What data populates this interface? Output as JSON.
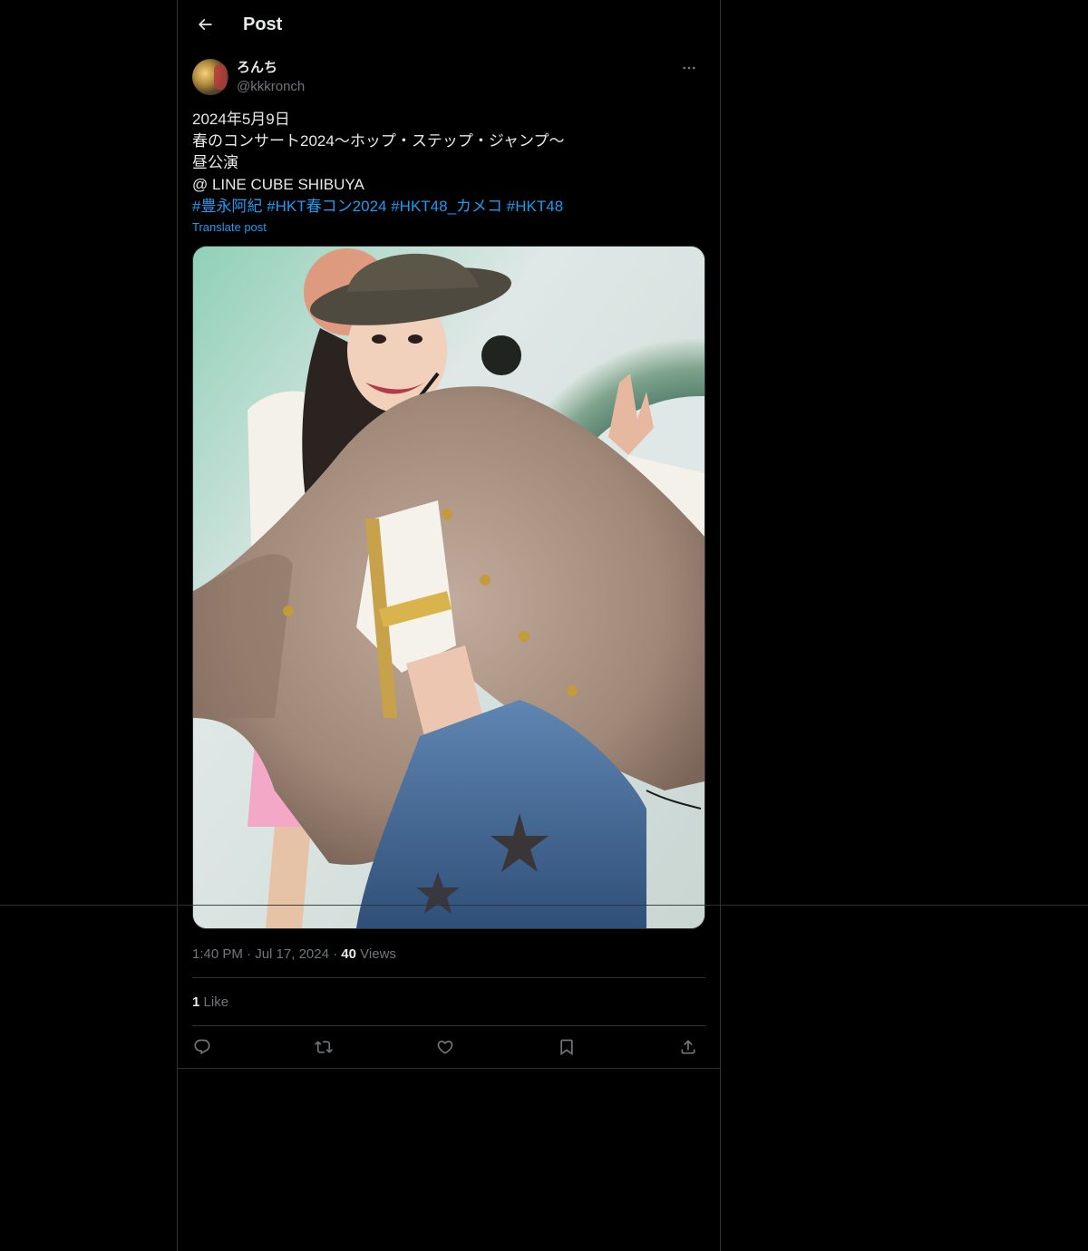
{
  "header": {
    "title": "Post"
  },
  "post": {
    "author": {
      "display_name": "ろんち",
      "handle": "@kkkronch"
    },
    "text_lines": [
      "2024年5月9日",
      "春のコンサート2024〜ホップ・ステップ・ジャンプ〜",
      "昼公演",
      "@ LINE CUBE SHIBUYA"
    ],
    "hashtags": [
      "#豊永阿紀",
      "#HKT春コン2024",
      "#HKT48_カメコ",
      "#HKT48"
    ],
    "translate_label": "Translate post",
    "time": "1:40 PM",
    "date": "Jul 17, 2024",
    "views_count": "40",
    "views_label": "Views",
    "likes_count": "1",
    "likes_label": "Like"
  },
  "colors": {
    "background": "#000000",
    "text": "#e7e9ea",
    "muted": "#71767b",
    "accent": "#1d9bf0",
    "border": "#2f3336"
  },
  "icons": {
    "back": "arrow-left-icon",
    "more": "more-horizontal-icon",
    "reply": "reply-icon",
    "repost": "repost-icon",
    "like": "heart-icon",
    "bookmark": "bookmark-icon",
    "share": "share-icon"
  }
}
